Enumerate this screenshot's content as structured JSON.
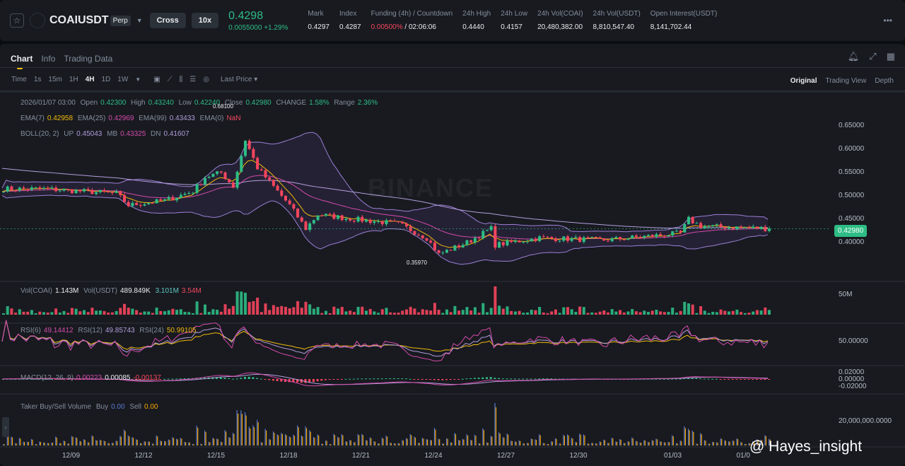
{
  "header": {
    "star_icon": "star-icon",
    "symbol": "COAIUSDT",
    "contract": "Perp",
    "margin_mode": "Cross",
    "leverage": "10x",
    "last_price": "0.4298",
    "change": "0.0055000 +1.29%",
    "stats": [
      {
        "label": "Mark",
        "value": "0.4297"
      },
      {
        "label": "Index",
        "value": "0.4287"
      },
      {
        "label": "Funding (4h) / Countdown",
        "value": "0.00500%",
        "value2": " / 02:06:06"
      },
      {
        "label": "24h High",
        "value": "0.4440"
      },
      {
        "label": "24h Low",
        "value": "0.4157"
      },
      {
        "label": "24h Vol(COAI)",
        "value": "20,480,382.00"
      },
      {
        "label": "24h Vol(USDT)",
        "value": "8,810,547.40"
      },
      {
        "label": "Open Interest(USDT)",
        "value": "8,141,702.44"
      }
    ]
  },
  "tabs": [
    "Chart",
    "Info",
    "Trading Data"
  ],
  "toolbar": {
    "time_label": "Time",
    "intervals": [
      "1s",
      "15m",
      "1H",
      "4H",
      "1D",
      "1W"
    ],
    "active_interval": "4H",
    "price_type": "Last Price",
    "views": [
      "Original",
      "Trading View",
      "Depth"
    ],
    "active_view": "Original"
  },
  "legend": {
    "datetime": "2026/01/07 03:00",
    "open_l": "Open",
    "open": "0.42300",
    "high_l": "High",
    "high": "0.43240",
    "low_l": "Low",
    "low": "0.42240",
    "close_l": "Close",
    "close": "0.42980",
    "change_l": "CHANGE",
    "change": "1.58%",
    "range_l": "Range",
    "range": "2.36%",
    "ema7_l": "EMA(7)",
    "ema7": "0.42958",
    "ema25_l": "EMA(25)",
    "ema25": "0.42969",
    "ema99_l": "EMA(99)",
    "ema99": "0.43433",
    "ema0_l": "EMA(0)",
    "ema0": "NaN",
    "boll_l": "BOLL(20, 2)",
    "up_l": "UP",
    "up": "0.45043",
    "mb_l": "MB",
    "mb": "0.43325",
    "dn_l": "DN",
    "dn": "0.41607"
  },
  "vol": {
    "l1": "Vol(COAI)",
    "v1": "1.143M",
    "l2": "Vol(USDT)",
    "v2": "489.849K",
    "v3": "3.101M",
    "v4": "3.54M",
    "axis": "50M"
  },
  "rsi": {
    "l6": "RSI(6)",
    "v6": "49.14412",
    "l12": "RSI(12)",
    "v12": "49.85743",
    "l24": "RSI(24)",
    "v24": "50.99105",
    "axis": "50.00000"
  },
  "macd": {
    "l": "MACD(12, 26, 9)",
    "v1": "0.00223",
    "v2": "0.00085",
    "v3": "-0.00137",
    "axis": [
      "0.02000",
      "0.00000",
      "-0.02000"
    ]
  },
  "taker": {
    "l": "Taker Buy/Sell Volume",
    "buy_l": "Buy",
    "buy": "0.00",
    "sell_l": "Sell",
    "sell": "0.00",
    "axis": "20,000,000.0000"
  },
  "annotations": {
    "high": "0.68100",
    "low": "0.35970"
  },
  "watermark": "BINANCE",
  "credit": "@ Hayes_insight",
  "colors": {
    "up": "#2ebd85",
    "down": "#f6465d",
    "bg": "#181a20"
  },
  "chart_data": {
    "type": "candlestick",
    "price_axis": [
      "0.65000",
      "0.60000",
      "0.55000",
      "0.50000",
      "0.45000",
      "0.40000"
    ],
    "price_ylim": [
      0.35,
      0.7
    ],
    "current_price": "0.42980",
    "x_ticks": [
      "12/09",
      "12/12",
      "12/15",
      "12/18",
      "12/21",
      "12/24",
      "12/27",
      "12/30",
      "01/03",
      "01/0"
    ],
    "close_path": [
      [
        0,
        0.515
      ],
      [
        10,
        0.515
      ],
      [
        28,
        0.505
      ],
      [
        31,
        0.48
      ],
      [
        40,
        0.49
      ],
      [
        47,
        0.51
      ],
      [
        50,
        0.54
      ],
      [
        54,
        0.55
      ],
      [
        57,
        0.52
      ],
      [
        60,
        0.62
      ],
      [
        63,
        0.56
      ],
      [
        66,
        0.53
      ],
      [
        71,
        0.48
      ],
      [
        75,
        0.43
      ],
      [
        78,
        0.46
      ],
      [
        87,
        0.45
      ],
      [
        98,
        0.44
      ],
      [
        105,
        0.41
      ],
      [
        108,
        0.375
      ],
      [
        115,
        0.4
      ],
      [
        121,
        0.43
      ],
      [
        122,
        0.395
      ],
      [
        133,
        0.41
      ],
      [
        149,
        0.405
      ],
      [
        168,
        0.42
      ],
      [
        170,
        0.45
      ],
      [
        173,
        0.435
      ],
      [
        190,
        0.43
      ]
    ]
  }
}
